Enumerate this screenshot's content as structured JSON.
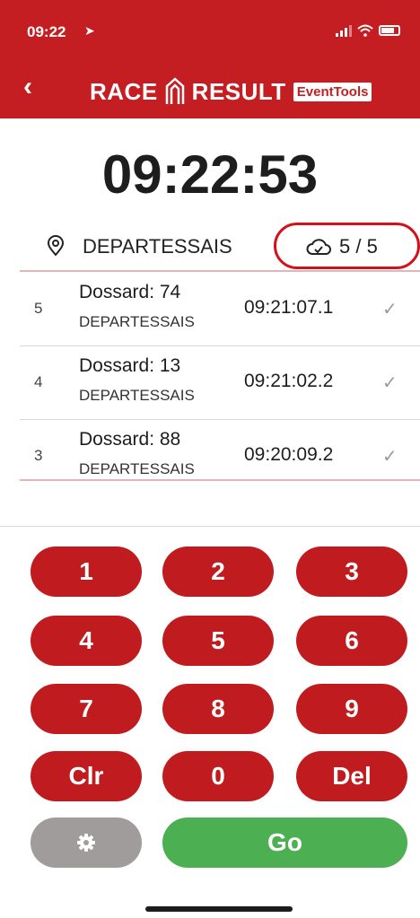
{
  "status_bar": {
    "time": "09:22",
    "location_arrow": "➤"
  },
  "header": {
    "back_icon": "‹",
    "logo_race": "RACE",
    "logo_result": "RESULT",
    "logo_badge": "EventTools",
    "background": "#c41e22"
  },
  "clock": "09:22:53",
  "location": {
    "name": "DEPARTESSAIS",
    "sync_count": "5 / 5"
  },
  "results": [
    {
      "num": "5",
      "bib": "Dossard: 74",
      "location": "DEPARTESSAIS",
      "time": "09:21:07.1",
      "check": "✓"
    },
    {
      "num": "4",
      "bib": "Dossard: 13",
      "location": "DEPARTESSAIS",
      "time": "09:21:02.2",
      "check": "✓"
    },
    {
      "num": "3",
      "bib": "Dossard: 88",
      "location": "DEPARTESSAIS",
      "time": "09:20:09.2",
      "check": "✓"
    }
  ],
  "keypad": {
    "k1": "1",
    "k2": "2",
    "k3": "3",
    "k4": "4",
    "k5": "5",
    "k6": "6",
    "k7": "7",
    "k8": "8",
    "k9": "9",
    "clear": "Clr",
    "k0": "0",
    "delete": "Del",
    "go": "Go"
  },
  "colors": {
    "accent_red": "#c01c20",
    "go_green": "#4caf52",
    "settings_gray": "#a09c9c"
  },
  "icons": [
    "location-arrow-icon",
    "signal-icon",
    "wifi-icon",
    "battery-icon",
    "back-icon",
    "logo-mark-icon",
    "location-pin-icon",
    "cloud-icon",
    "check-icon",
    "gear-icon"
  ]
}
